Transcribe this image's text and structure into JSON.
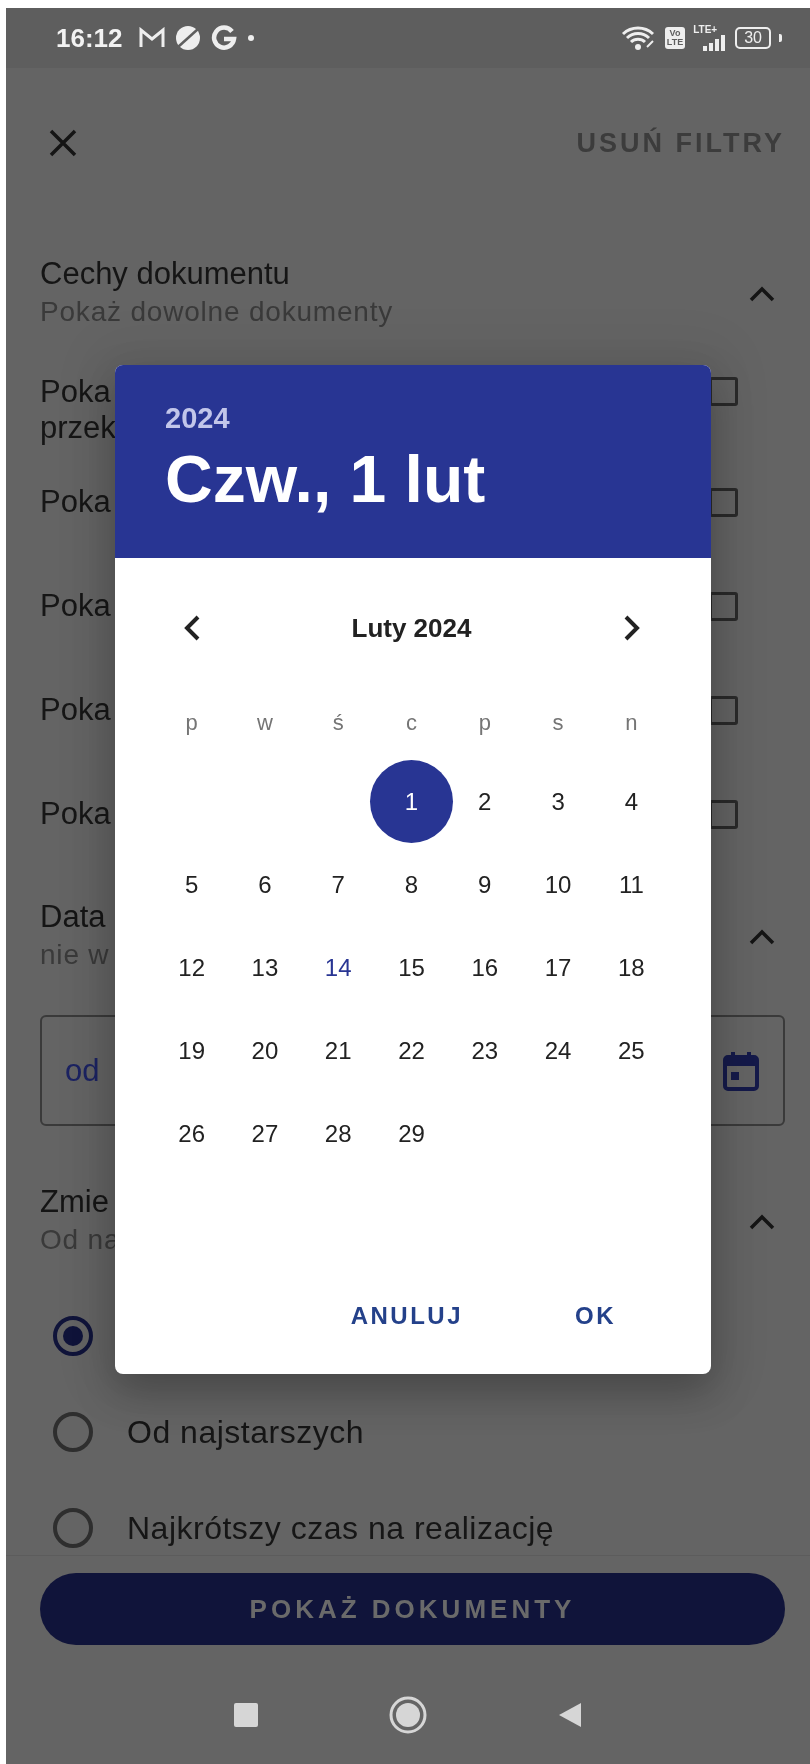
{
  "status_bar": {
    "time": "16:12",
    "volte": [
      "Vo",
      "LTE"
    ],
    "network": "LTE+",
    "battery": "30"
  },
  "toolbar": {
    "action": "USUŃ FILTRY"
  },
  "sections": [
    {
      "kind": "checkboxes",
      "title": "Cechy dokumentu",
      "subtitle": "Pokaż dowolne dokumenty",
      "expanded": true,
      "items": [
        {
          "lines": [
            "Poka",
            "przek"
          ],
          "checked": false
        },
        {
          "lines": [
            "Poka"
          ],
          "checked": false
        },
        {
          "lines": [
            "Poka"
          ],
          "checked": false
        },
        {
          "lines": [
            "Poka"
          ],
          "checked": false
        },
        {
          "lines": [
            "Poka"
          ],
          "checked": false
        }
      ]
    },
    {
      "kind": "date",
      "title": "Data",
      "subtitle": "nie w",
      "expanded": true,
      "field": {
        "value": "od"
      }
    },
    {
      "kind": "radios",
      "title": "Zmie",
      "subtitle": "Od na",
      "expanded": true,
      "items": [
        {
          "selected": true
        },
        {
          "label": "Od najstarszych",
          "selected": false
        },
        {
          "label": "Najkrótszy czas na realizację",
          "selected": false
        }
      ]
    }
  ],
  "primary_button": "POKAŻ DOKUMENTY",
  "dialog": {
    "year": "2024",
    "date": "Czw., 1 lut",
    "month": "Luty 2024",
    "weekdays": [
      "p",
      "w",
      "ś",
      "c",
      "p",
      "s",
      "n"
    ],
    "weeks": [
      [
        {
          "day": "1",
          "selected": true,
          "today": false
        },
        {
          "day": "2",
          "selected": false,
          "today": false
        },
        {
          "day": "3",
          "selected": false,
          "today": false
        },
        {
          "day": "4",
          "selected": false,
          "today": false
        }
      ],
      [
        {
          "day": "5",
          "selected": false,
          "today": false
        },
        {
          "day": "6",
          "selected": false,
          "today": false
        },
        {
          "day": "7",
          "selected": false,
          "today": false
        },
        {
          "day": "8",
          "selected": false,
          "today": false
        },
        {
          "day": "9",
          "selected": false,
          "today": false
        },
        {
          "day": "10",
          "selected": false,
          "today": false
        },
        {
          "day": "11",
          "selected": false,
          "today": false
        }
      ],
      [
        {
          "day": "12",
          "selected": false,
          "today": false
        },
        {
          "day": "13",
          "selected": false,
          "today": false
        },
        {
          "day": "14",
          "selected": false,
          "today": true
        },
        {
          "day": "15",
          "selected": false,
          "today": false
        },
        {
          "day": "16",
          "selected": false,
          "today": false
        },
        {
          "day": "17",
          "selected": false,
          "today": false
        },
        {
          "day": "18",
          "selected": false,
          "today": false
        }
      ],
      [
        {
          "day": "19",
          "selected": false,
          "today": false
        },
        {
          "day": "20",
          "selected": false,
          "today": false
        },
        {
          "day": "21",
          "selected": false,
          "today": false
        },
        {
          "day": "22",
          "selected": false,
          "today": false
        },
        {
          "day": "23",
          "selected": false,
          "today": false
        },
        {
          "day": "24",
          "selected": false,
          "today": false
        },
        {
          "day": "25",
          "selected": false,
          "today": false
        }
      ],
      [
        {
          "day": "26",
          "selected": false,
          "today": false
        },
        {
          "day": "27",
          "selected": false,
          "today": false
        },
        {
          "day": "28",
          "selected": false,
          "today": false
        },
        {
          "day": "29",
          "selected": false,
          "today": false
        }
      ]
    ],
    "buttons": [
      "ANULUJ",
      "OK"
    ]
  }
}
